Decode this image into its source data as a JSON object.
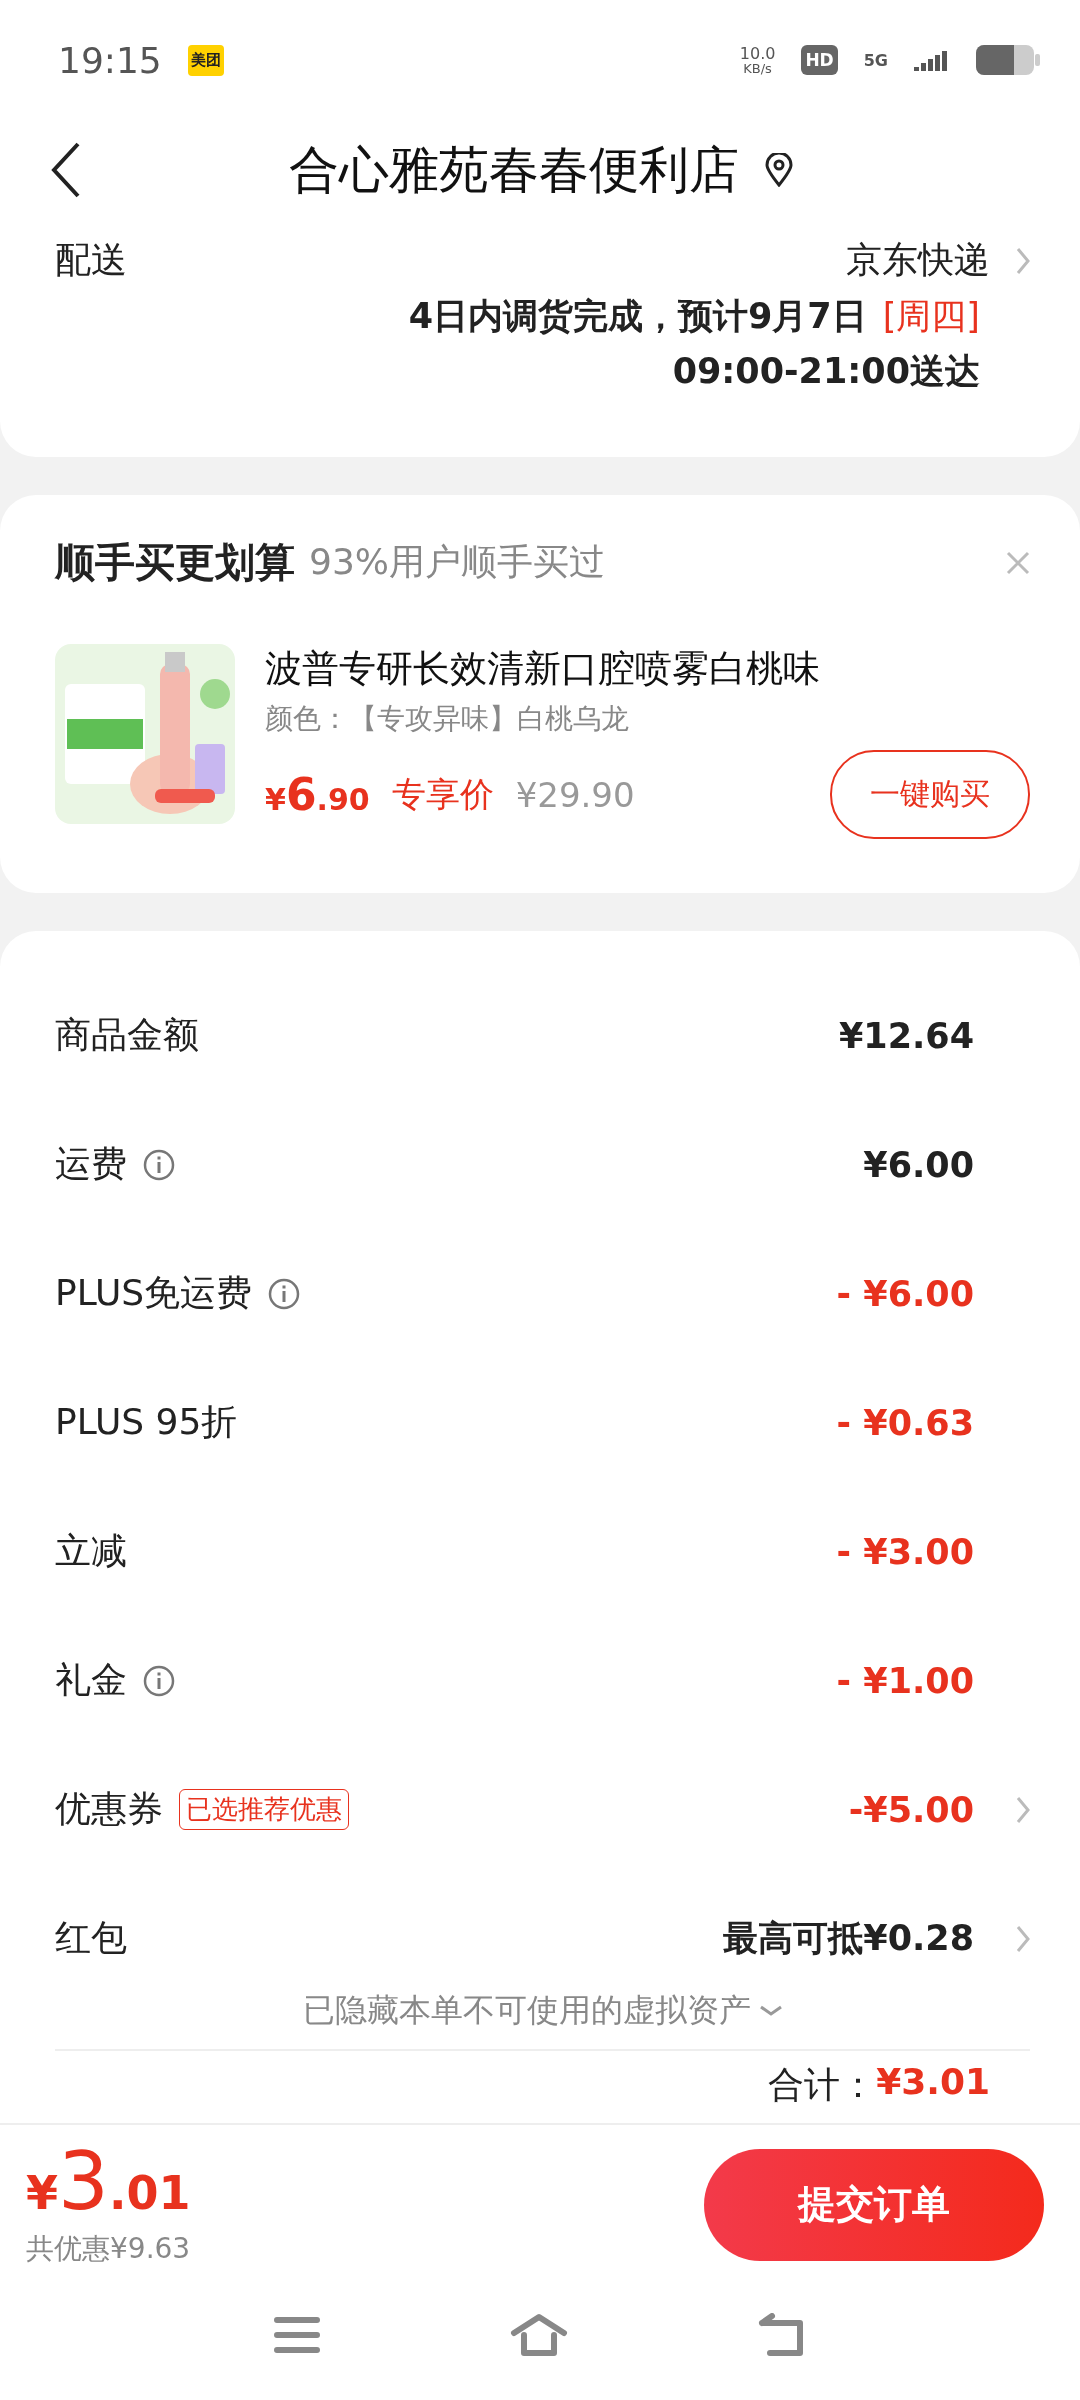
{
  "status_bar": {
    "time": "19:15",
    "app_badge": "美团",
    "net_speed": "10.0",
    "net_unit": "KB/s",
    "hd": "HD",
    "network": "5G"
  },
  "header": {
    "title": "合心雅苑春春便利店"
  },
  "delivery": {
    "label": "配送",
    "carrier": "京东快递",
    "eta": "4日内调货完成，预计9月7日",
    "weekday": "[周四]",
    "window": "09:00-21:00送达"
  },
  "upsell": {
    "title": "顺手买更划算",
    "subtitle": "93%用户顺手买过",
    "product": {
      "kind": "picture",
      "name": "波普专研长效清新口腔喷雾白桃味",
      "spec": "颜色：【专攻异味】白桃乌龙",
      "currency": "¥",
      "price_int": "6",
      "price_dec": ".90",
      "price_label": "专享价",
      "original_price": "¥29.90",
      "button": "一键购买"
    }
  },
  "summary": {
    "rows": [
      {
        "label": "商品金额",
        "info": false,
        "discount": false,
        "chevron": false,
        "value": "¥12.64"
      },
      {
        "label": "运费",
        "info": true,
        "discount": false,
        "chevron": false,
        "value": "¥6.00"
      },
      {
        "label": "PLUS免运费",
        "info": true,
        "discount": true,
        "chevron": false,
        "value": "- ¥6.00"
      },
      {
        "label": "PLUS 95折",
        "info": false,
        "discount": true,
        "chevron": false,
        "value": "- ¥0.63"
      },
      {
        "label": "立减",
        "info": false,
        "discount": true,
        "chevron": false,
        "value": "- ¥3.00"
      },
      {
        "label": "礼金",
        "info": true,
        "discount": true,
        "chevron": false,
        "value": "- ¥1.00"
      },
      {
        "label": "优惠券",
        "tag": "已选推荐优惠",
        "info": false,
        "discount": true,
        "chevron": true,
        "value": "-¥5.00"
      },
      {
        "label": "红包",
        "info": false,
        "discount": false,
        "chevron": true,
        "value": "最高可抵¥0.28"
      }
    ],
    "hidden_note": "已隐藏本单不可使用的虚拟资产",
    "total_label": "合计：",
    "total_value": "¥3.01"
  },
  "bottom_bar": {
    "currency": "¥",
    "total_int": "3",
    "total_dec": ".01",
    "savings": "共优惠¥9.63",
    "submit": "提交订单"
  }
}
